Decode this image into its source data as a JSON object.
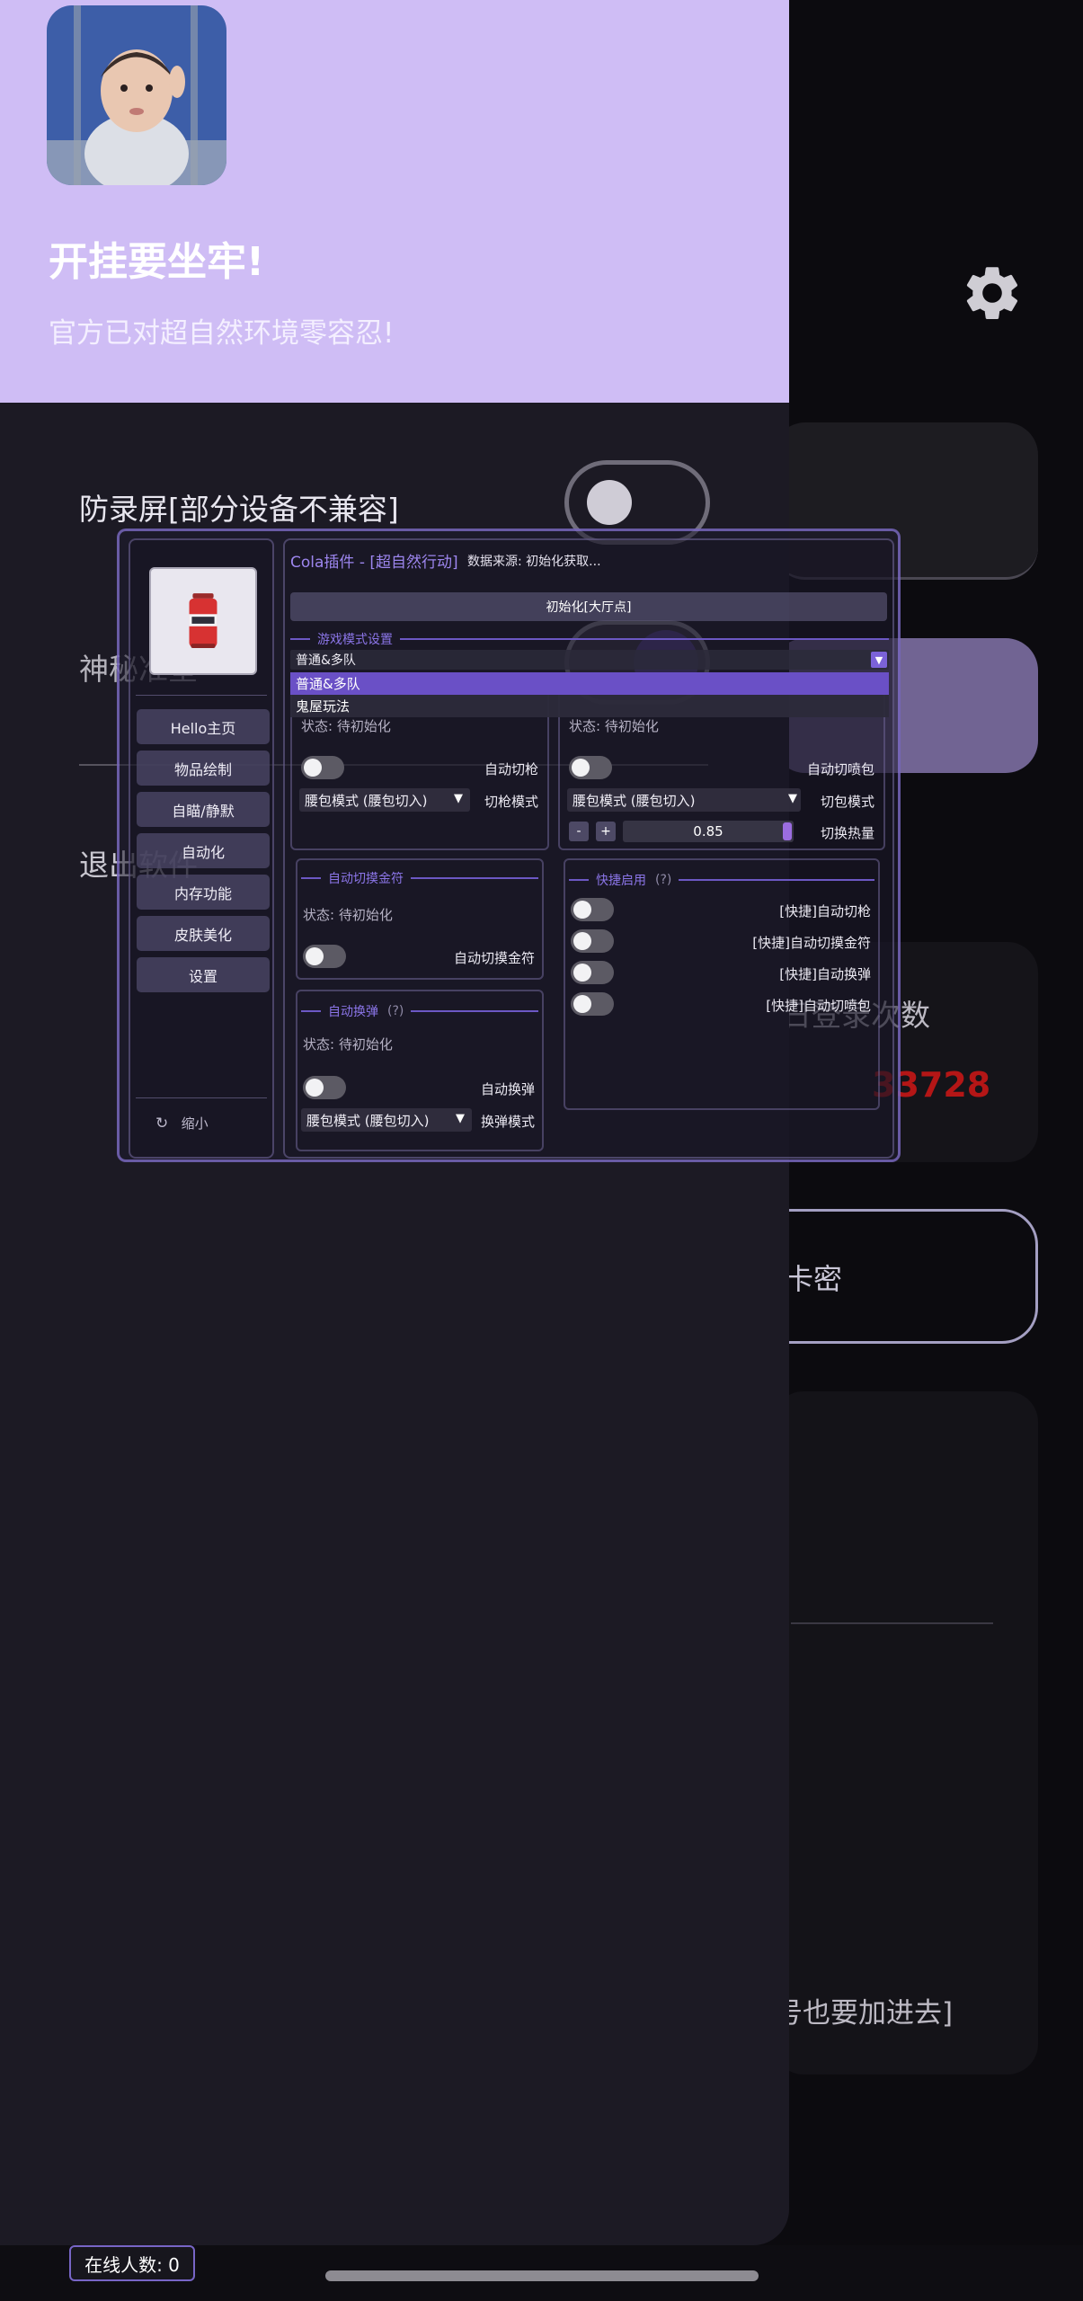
{
  "drawer": {
    "title": "开挂要坐牢!",
    "subtitle": "官方已对超自然环境零容忍!",
    "items": [
      {
        "label": "防录屏[部分设备不兼容]"
      },
      {
        "label": "神秘准星"
      },
      {
        "label": "退出软件"
      }
    ]
  },
  "background": {
    "login_label": "日登录次数",
    "login_count": "33728",
    "cardkey_label": "卡密",
    "note": "号也要加进去]"
  },
  "online": {
    "label": "在线人数: 0"
  },
  "overlay": {
    "title": "Cola插件 - [超自然行动]",
    "source": "数据来源: 初始化获取...",
    "init_button": "初始化[大厅点]",
    "game_mode_section": "游戏模式设置",
    "game_mode_selected": "普通&多队",
    "game_mode_options": [
      "普通&多队",
      "鬼屋玩法"
    ],
    "nav": [
      "Hello主页",
      "物品绘制",
      "自瞄/静默",
      "自动化",
      "内存功能",
      "皮肤美化",
      "设置"
    ],
    "shrink": "缩小",
    "status_text": "状态: 待初始化",
    "gun": {
      "toggle": "自动切枪",
      "mode_value": "腰包模式 (腰包切入)",
      "mode_label": "切枪模式"
    },
    "spray": {
      "toggle": "自动切喷包",
      "mode_value": "腰包模式 (腰包切入)",
      "mode_label": "切包模式",
      "minus": "-",
      "plus": "+",
      "heat_value": "0.85",
      "heat_label": "切换热量"
    },
    "talisman": {
      "section": "自动切摸金符",
      "toggle": "自动切摸金符"
    },
    "reload": {
      "section": "自动换弹",
      "hint": "(?)",
      "toggle": "自动换弹",
      "mode_value": "腰包模式 (腰包切入)",
      "mode_label": "换弹模式"
    },
    "quick": {
      "section": "快捷启用",
      "hint": "(?)",
      "items": [
        "[快捷]自动切枪",
        "[快捷]自动切摸金符",
        "[快捷]自动换弹",
        "[快捷]自动切喷包"
      ]
    }
  },
  "colors": {
    "accent": "#7b62d8",
    "header": "#cfbdf5",
    "count": "#b41616"
  }
}
